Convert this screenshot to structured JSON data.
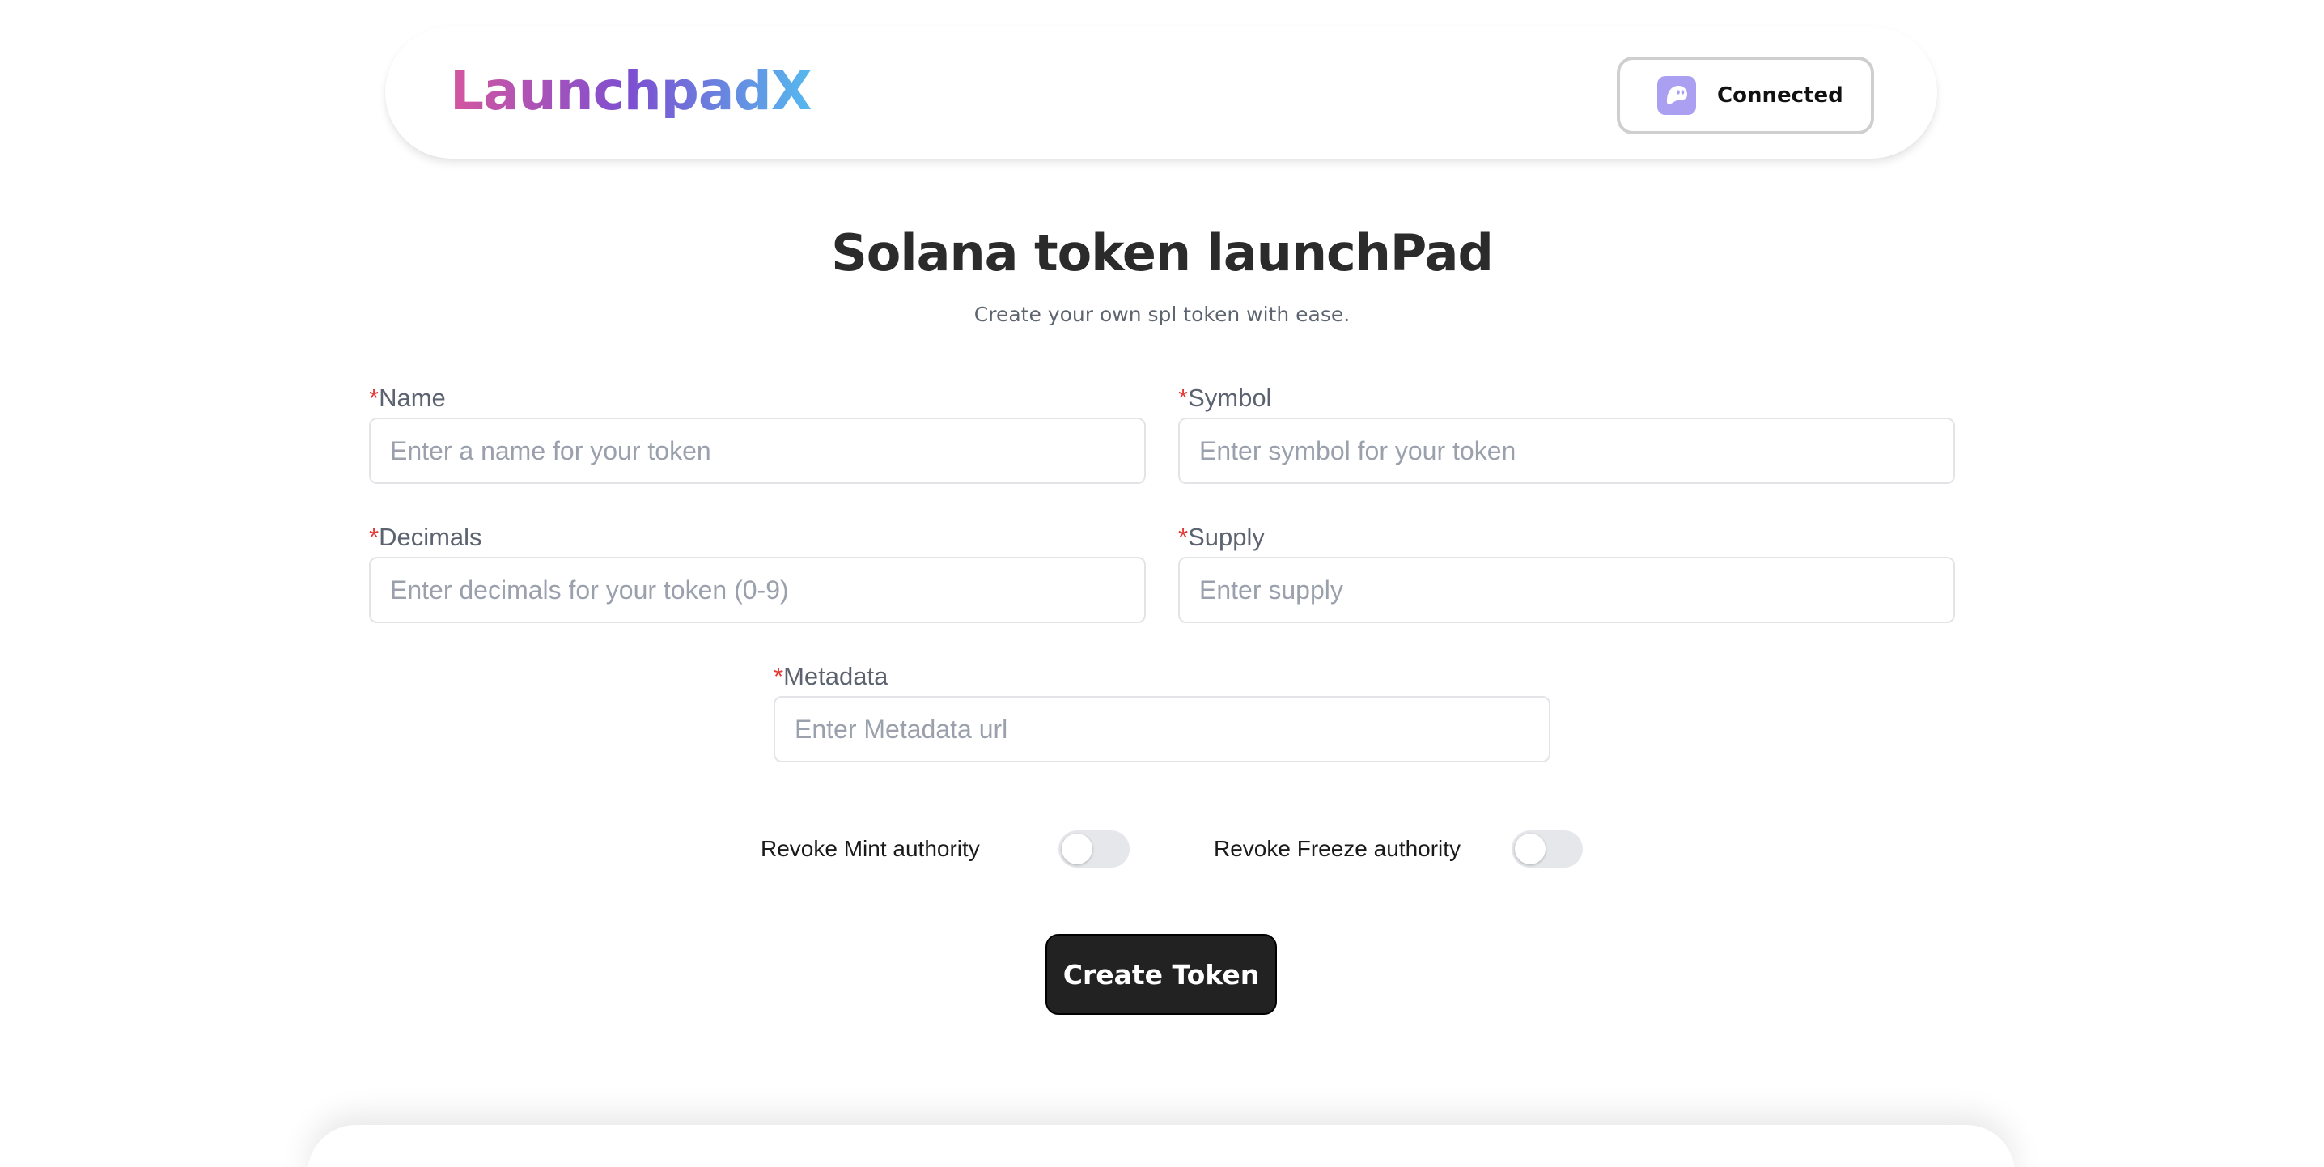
{
  "header": {
    "logo": "LaunchpadX",
    "wallet_button_label": "Connected",
    "wallet_icon": "phantom-ghost-icon"
  },
  "main": {
    "title": "Solana token launchPad",
    "subtitle": "Create your own spl token with ease."
  },
  "form": {
    "required_marker": "*",
    "name": {
      "label": "Name",
      "placeholder": "Enter a name for your token",
      "value": ""
    },
    "symbol": {
      "label": "Symbol",
      "placeholder": "Enter symbol for your token",
      "value": ""
    },
    "decimals": {
      "label": "Decimals",
      "placeholder": "Enter decimals for your token (0-9)",
      "value": ""
    },
    "supply": {
      "label": "Supply",
      "placeholder": "Enter supply",
      "value": ""
    },
    "metadata": {
      "label": "Metadata",
      "placeholder": "Enter Metadata url",
      "value": ""
    },
    "revoke_mint": {
      "label": "Revoke Mint authority",
      "on": false
    },
    "revoke_freeze": {
      "label": "Revoke Freeze authority",
      "on": false
    },
    "submit_label": "Create Token"
  },
  "colors": {
    "logo_gradient": [
      "#d4569f",
      "#7d4fd1",
      "#55b9ee"
    ],
    "required": "#e53935",
    "primary_button": "#222222",
    "wallet_icon_bg": "#ab9ff2"
  }
}
